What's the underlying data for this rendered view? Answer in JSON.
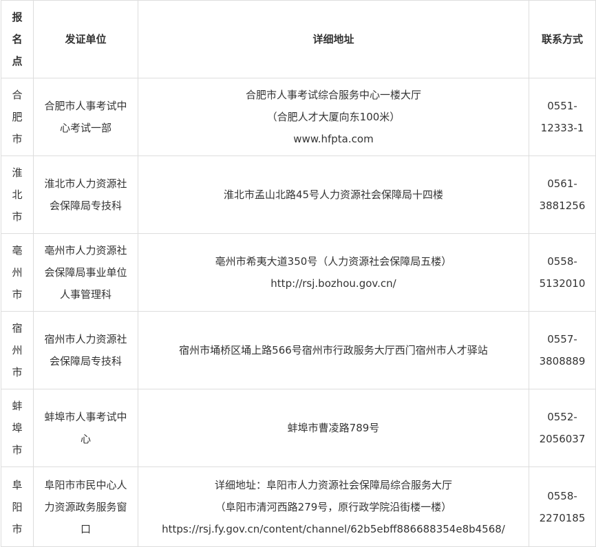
{
  "headers": {
    "city": [
      "报",
      "名",
      "点"
    ],
    "org": "发证单位",
    "address": "详细地址",
    "contact": "联系方式"
  },
  "rows": [
    {
      "city": [
        "合",
        "肥",
        "市"
      ],
      "org": [
        "合肥市人事考试中",
        "心考试一部"
      ],
      "address": [
        "合肥市人事考试综合服务中心一楼大厅",
        "（合肥人才大厦向东100米）",
        "www.hfpta.com"
      ],
      "phone": [
        "0551-",
        "12333-1"
      ]
    },
    {
      "city": [
        "淮",
        "北",
        "市"
      ],
      "org": [
        "淮北市人力资源社",
        "会保障局专技科"
      ],
      "address": [
        "淮北市孟山北路45号人力资源社会保障局十四楼"
      ],
      "phone": [
        "0561-",
        "3881256"
      ]
    },
    {
      "city": [
        "亳",
        "州",
        "市"
      ],
      "org": [
        "亳州市人力资源社",
        "会保障局事业单位",
        "人事管理科"
      ],
      "address": [
        "亳州市希夷大道350号（人力资源社会保障局五楼）",
        "http://rsj.bozhou.gov.cn/"
      ],
      "phone": [
        "0558-",
        "5132010"
      ]
    },
    {
      "city": [
        "宿",
        "州",
        "市"
      ],
      "org": [
        "宿州市人力资源社",
        "会保障局专技科"
      ],
      "address": [
        "宿州市埇桥区埇上路566号宿州市行政服务大厅西门宿州市人才驿站"
      ],
      "phone": [
        "0557-",
        "3808889"
      ]
    },
    {
      "city": [
        "蚌",
        "埠",
        "市"
      ],
      "org": [
        "蚌埠市人事考试中",
        "心"
      ],
      "address": [
        "蚌埠市曹凌路789号"
      ],
      "phone": [
        "0552-",
        "2056037"
      ]
    },
    {
      "city": [
        "阜",
        "阳",
        "市"
      ],
      "org": [
        "阜阳市市民中心人",
        "力资源政务服务窗",
        "口"
      ],
      "address": [
        "详细地址：阜阳市人力资源社会保障局综合服务大厅",
        "（阜阳市清河西路279号，原行政学院沿街楼一楼）",
        "https://rsj.fy.gov.cn/content/channel/62b5ebff886688354e8b4568/"
      ],
      "phone": [
        "0558-",
        "2270185"
      ]
    }
  ]
}
